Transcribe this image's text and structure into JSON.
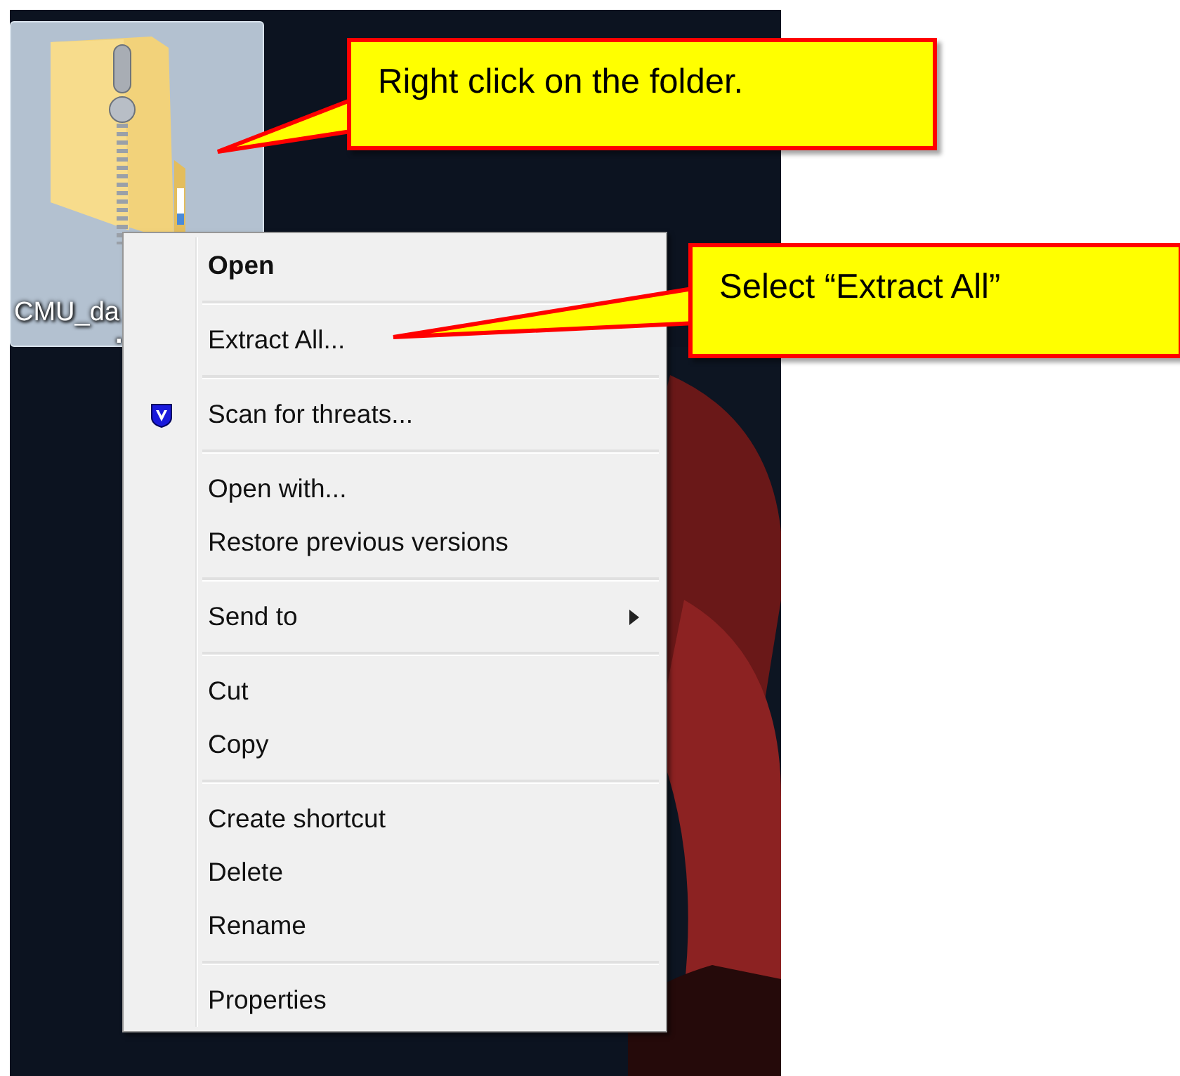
{
  "desktop": {
    "icon": {
      "label_lines": [
        "CMU_da",
        "."
      ],
      "selected": true
    }
  },
  "context_menu": {
    "groups": [
      {
        "items": [
          {
            "label": "Open",
            "default": true
          }
        ]
      },
      {
        "items": [
          {
            "label": "Extract All...",
            "default": false
          }
        ]
      },
      {
        "items": [
          {
            "label": "Scan for threats...",
            "default": false,
            "kind": "shield"
          }
        ]
      },
      {
        "items": [
          {
            "label": "Open with...",
            "default": false
          },
          {
            "label": "Restore previous versions",
            "default": false
          }
        ]
      },
      {
        "items": [
          {
            "label": "Send to",
            "default": false,
            "has_submenu": true
          }
        ]
      },
      {
        "items": [
          {
            "label": "Cut",
            "default": false
          },
          {
            "label": "Copy",
            "default": false
          }
        ]
      },
      {
        "items": [
          {
            "label": "Create shortcut",
            "default": false
          },
          {
            "label": "Delete",
            "default": false
          },
          {
            "label": "Rename",
            "default": false
          }
        ]
      },
      {
        "items": [
          {
            "label": "Properties",
            "default": false
          }
        ]
      }
    ]
  },
  "callouts": [
    {
      "text": "Right click on the folder."
    },
    {
      "text": "Select “Extract All”"
    }
  ]
}
